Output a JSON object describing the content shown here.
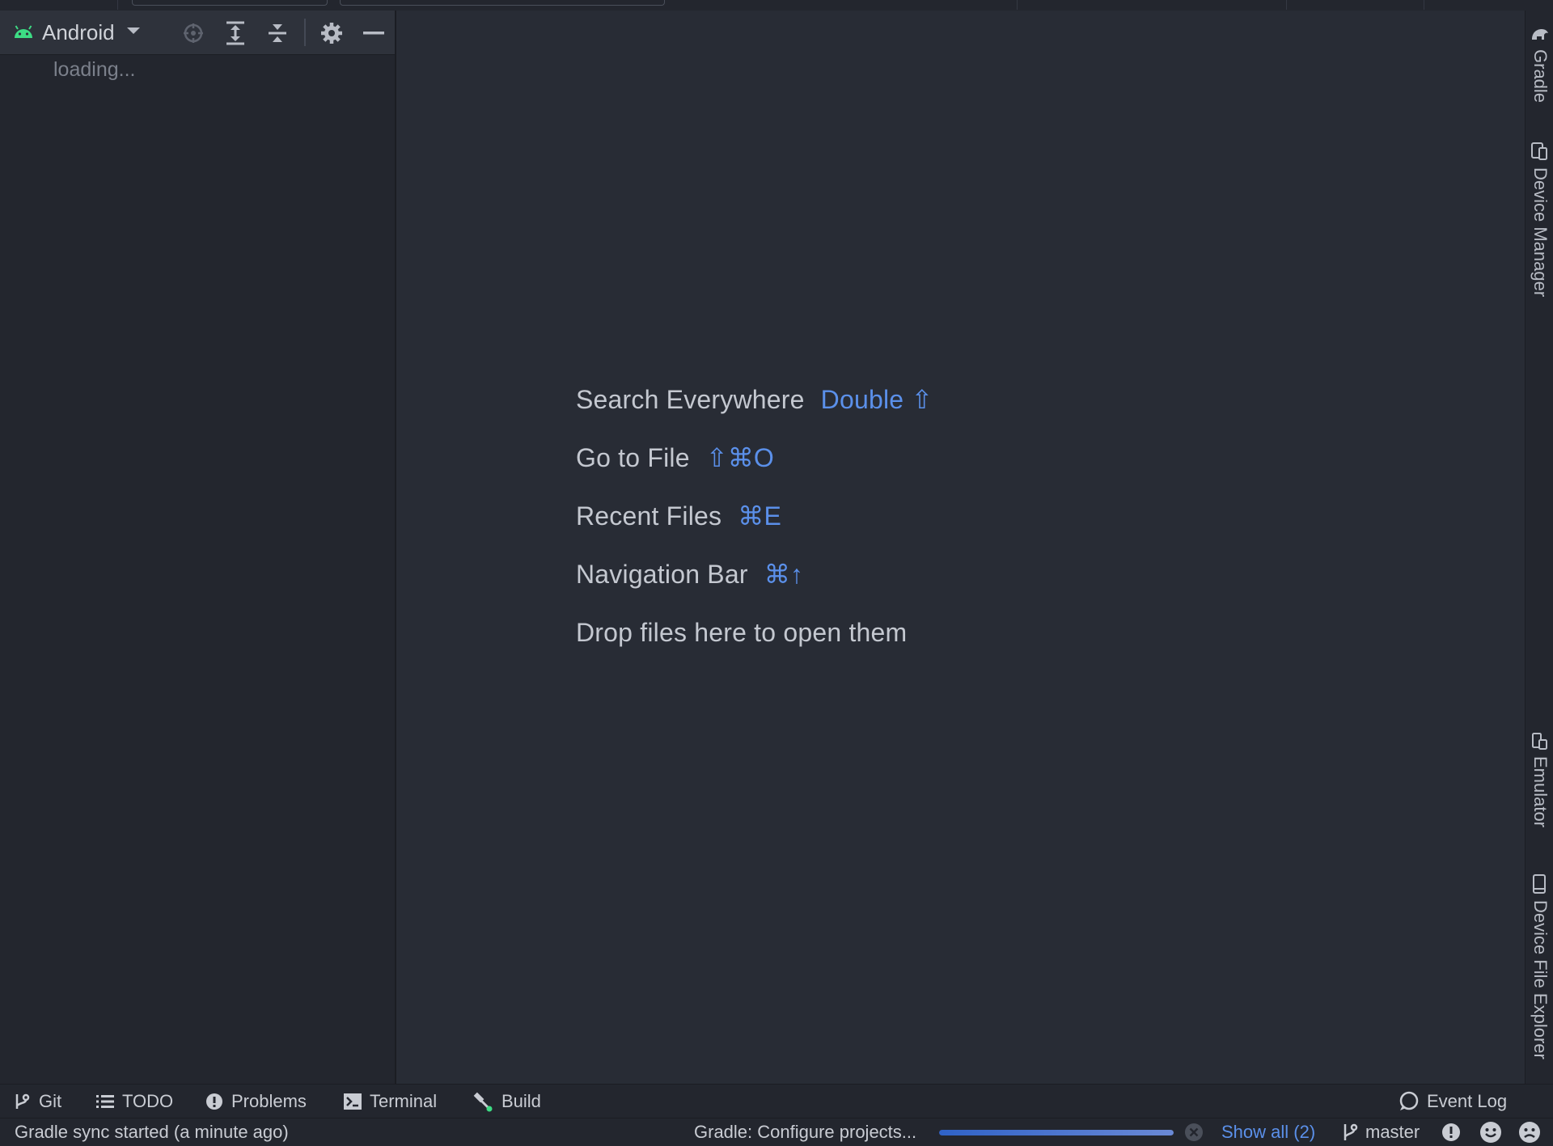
{
  "project_panel": {
    "view_label": "Android",
    "loading_text": "loading..."
  },
  "editor_hints": [
    {
      "label": "Search Everywhere",
      "shortcut": "Double ⇧"
    },
    {
      "label": "Go to File",
      "shortcut": "⇧⌘O"
    },
    {
      "label": "Recent Files",
      "shortcut": "⌘E"
    },
    {
      "label": "Navigation Bar",
      "shortcut": "⌘↑"
    },
    {
      "label": "Drop files here to open them",
      "shortcut": ""
    }
  ],
  "right_tool_windows": [
    "Gradle",
    "Device Manager",
    "Emulator",
    "Device File Explorer"
  ],
  "bottom_tools": {
    "git": "Git",
    "todo": "TODO",
    "problems": "Problems",
    "terminal": "Terminal",
    "build": "Build",
    "event_log": "Event Log"
  },
  "status_bar": {
    "message": "Gradle sync started (a minute ago)",
    "task": "Gradle: Configure projects...",
    "progress": 1.0,
    "show_all": "Show all (2)",
    "branch": "master"
  },
  "colors": {
    "background": "#282c35",
    "panel": "#23262e",
    "accent_link": "#5b90ea",
    "android_green": "#3ddc84",
    "progress": "#2f62c7"
  }
}
